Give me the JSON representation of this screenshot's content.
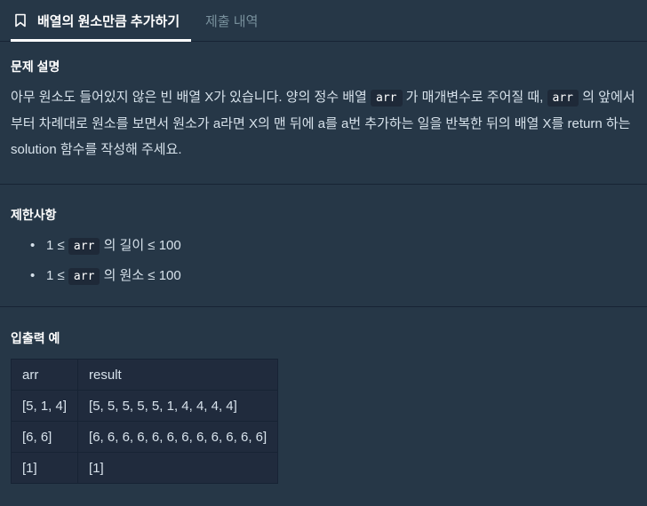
{
  "tabs": {
    "active": "배열의 원소만큼 추가하기",
    "inactive": "제출 내역"
  },
  "sections": {
    "description_title": "문제 설명",
    "description": {
      "p1": "아무 원소도 들어있지 않은 빈 배열 X가 있습니다. 양의 정수 배열 ",
      "code1": "arr",
      "p2": " 가 매개변수로 주어질 때, ",
      "code2": "arr",
      "p3": " 의 앞에서부터 차례대로 원소를 보면서 원소가 a라면 X의 맨 뒤에 a를 a번 추가하는 일을 반복한 뒤의 배열 X를 return 하는 solution 함수를 작성해 주세요."
    },
    "constraints_title": "제한사항",
    "constraints": [
      {
        "pre": "1 ≤ ",
        "code": "arr",
        "post": " 의 길이 ≤ 100"
      },
      {
        "pre": "1 ≤ ",
        "code": "arr",
        "post": " 의 원소 ≤ 100"
      }
    ],
    "examples_title": "입출력 예"
  },
  "table": {
    "headers": [
      "arr",
      "result"
    ],
    "rows": [
      [
        "[5, 1, 4]",
        "[5, 5, 5, 5, 5, 1, 4, 4, 4, 4]"
      ],
      [
        "[6, 6]",
        "[6, 6, 6, 6, 6, 6, 6, 6, 6, 6, 6, 6]"
      ],
      [
        "[1]",
        "[1]"
      ]
    ]
  },
  "icons": {
    "tab": "bookmark-icon"
  },
  "colors": {
    "background": "#263747",
    "divider": "#172334",
    "table_bg": "#202B3D",
    "text": "#D7E2EB",
    "muted": "#78909C"
  }
}
